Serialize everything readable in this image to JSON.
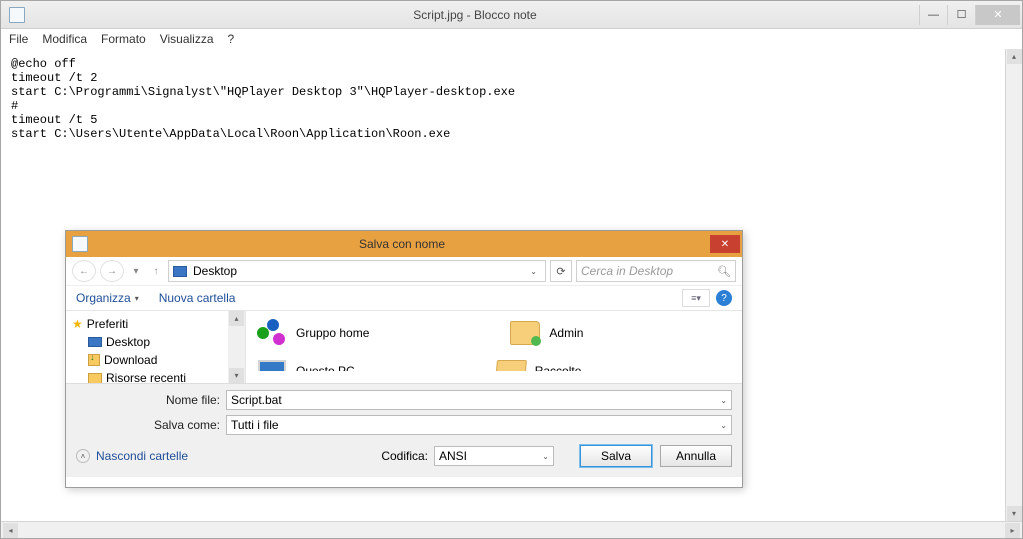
{
  "window": {
    "title": "Script.jpg - Blocco note"
  },
  "menu": {
    "file": "File",
    "edit": "Modifica",
    "format": "Formato",
    "view": "Visualizza",
    "help": "?"
  },
  "editor": {
    "content": "@echo off\ntimeout /t 2\nstart C:\\Programmi\\Signalyst\\\"HQPlayer Desktop 3\"\\HQPlayer-desktop.exe\n#\ntimeout /t 5\nstart C:\\Users\\Utente\\AppData\\Local\\Roon\\Application\\Roon.exe"
  },
  "dialog": {
    "title": "Salva con nome",
    "address": "Desktop",
    "search_placeholder": "Cerca in Desktop",
    "organize": "Organizza",
    "new_folder": "Nuova cartella",
    "tree": {
      "favorites": "Preferiti",
      "desktop": "Desktop",
      "download": "Download",
      "recent": "Risorse recenti"
    },
    "items": {
      "homegroup": "Gruppo home",
      "admin": "Admin",
      "thispc": "Questo PC",
      "collection": "Raccolte"
    },
    "filename_label": "Nome file:",
    "filename_value": "Script.bat",
    "savetype_label": "Salva come:",
    "savetype_value": "Tutti i file",
    "hide_folders": "Nascondi cartelle",
    "encoding_label": "Codifica:",
    "encoding_value": "ANSI",
    "save": "Salva",
    "cancel": "Annulla"
  }
}
